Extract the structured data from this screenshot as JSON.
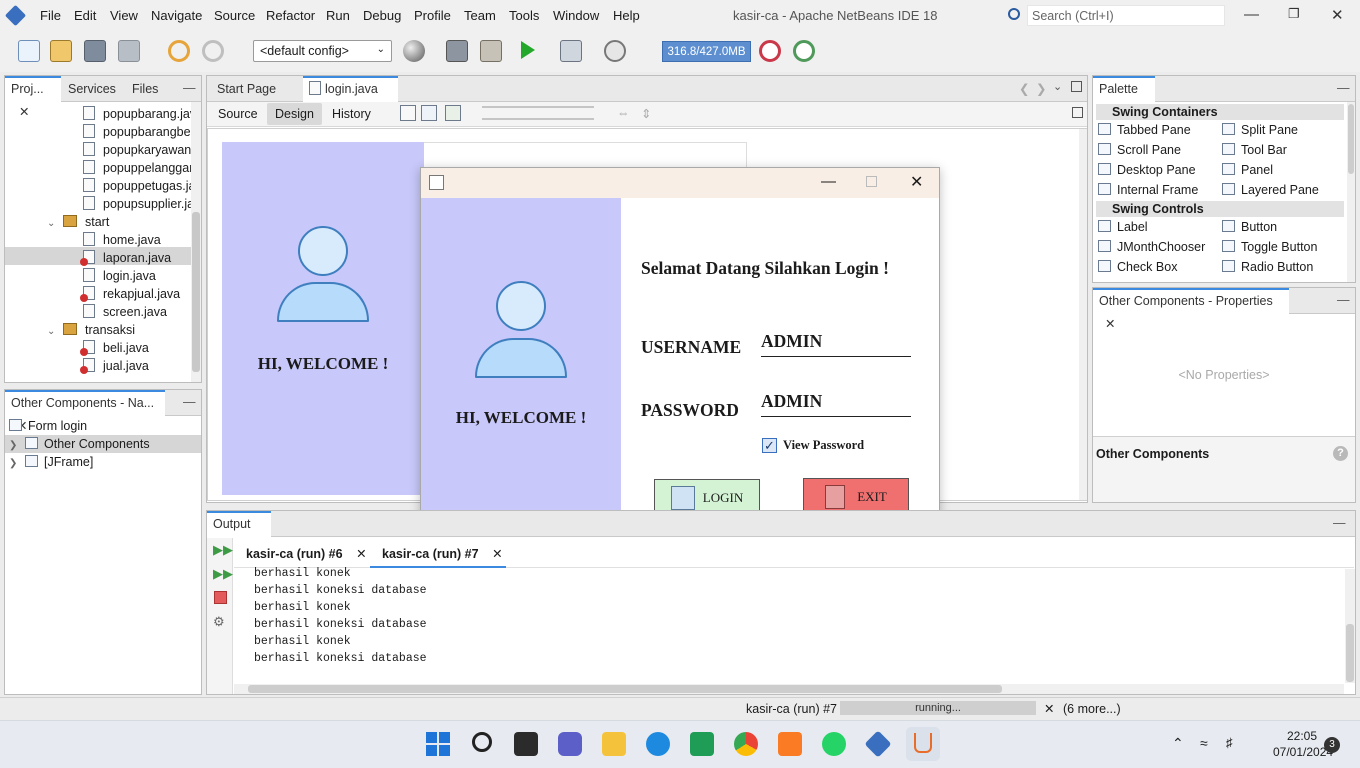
{
  "app": {
    "title": "kasir-ca - Apache NetBeans IDE 18"
  },
  "menu": [
    "File",
    "Edit",
    "View",
    "Navigate",
    "Source",
    "Refactor",
    "Run",
    "Debug",
    "Profile",
    "Team",
    "Tools",
    "Window",
    "Help"
  ],
  "search": {
    "placeholder": "Search (Ctrl+I)"
  },
  "toolbar": {
    "config": "<default config>",
    "memory": "316.8/427.0MB"
  },
  "projects": {
    "tabs": [
      "Proj...",
      "Services",
      "Files"
    ],
    "items": [
      {
        "label": "popupbarang.jav",
        "kind": "file",
        "err": false
      },
      {
        "label": "popupbarangbel",
        "kind": "file",
        "err": false
      },
      {
        "label": "popupkaryawan.",
        "kind": "file",
        "err": false
      },
      {
        "label": "popuppelanggar",
        "kind": "file",
        "err": false
      },
      {
        "label": "popuppetugas.ja",
        "kind": "file",
        "err": false
      },
      {
        "label": "popupsupplier.ja",
        "kind": "file",
        "err": false
      },
      {
        "label": "start",
        "kind": "pkg"
      },
      {
        "label": "home.java",
        "kind": "file",
        "err": false
      },
      {
        "label": "laporan.java",
        "kind": "file",
        "err": true
      },
      {
        "label": "login.java",
        "kind": "file",
        "err": false
      },
      {
        "label": "rekapjual.java",
        "kind": "file",
        "err": true
      },
      {
        "label": "screen.java",
        "kind": "file",
        "err": false
      },
      {
        "label": "transaksi",
        "kind": "pkg"
      },
      {
        "label": "beli.java",
        "kind": "file",
        "err": true
      },
      {
        "label": "jual.java",
        "kind": "file",
        "err": true
      }
    ]
  },
  "navigator": {
    "title": "Other Components - Na...",
    "items": [
      "Form login",
      "Other Components",
      "[JFrame]"
    ]
  },
  "editor": {
    "tabs": [
      "Start Page",
      "login.java"
    ],
    "views": [
      "Source",
      "Design",
      "History"
    ]
  },
  "form": {
    "welcome": "HI, WELCOME !"
  },
  "window": {
    "greeting": "Selamat Datang Silahkan Login !",
    "username_label": "USERNAME",
    "username_value": "ADMIN",
    "password_label": "PASSWORD",
    "password_value": "ADMIN",
    "show_password": "View Password",
    "show_password_checked": true,
    "login": "LOGIN",
    "exit": "EXIT",
    "welcome": "HI, WELCOME !"
  },
  "palette": {
    "title": "Palette",
    "sections": [
      {
        "name": "Swing Containers",
        "items": [
          "Tabbed Pane",
          "Split Pane",
          "Scroll Pane",
          "Tool Bar",
          "Desktop Pane",
          "Panel",
          "Internal Frame",
          "Layered Pane"
        ]
      },
      {
        "name": "Swing Controls",
        "items": [
          "Label",
          "Button",
          "JMonthChooser",
          "Toggle Button",
          "Check Box",
          "Radio Button"
        ]
      }
    ]
  },
  "properties": {
    "title": "Other Components - Properties",
    "empty": "<No Properties>",
    "footer": "Other Components"
  },
  "output": {
    "title": "Output",
    "tabs": [
      "kasir-ca (run) #6",
      "kasir-ca (run) #7"
    ],
    "lines": [
      "berhasil konek",
      "berhasil koneksi database",
      "berhasil konek",
      "berhasil koneksi database",
      "berhasil konek",
      "berhasil koneksi database"
    ]
  },
  "status": {
    "task": "kasir-ca (run) #7",
    "progress": "running...",
    "more": "(6 more...)"
  },
  "taskbar": {
    "time": "22:05",
    "date": "07/01/2024",
    "notifications": "3"
  },
  "colors": {
    "form_bg": "#c8c8fa",
    "login_btn": "#d4f3d4",
    "exit_btn": "#f07070",
    "memory_bar": "#5d8fd0"
  }
}
